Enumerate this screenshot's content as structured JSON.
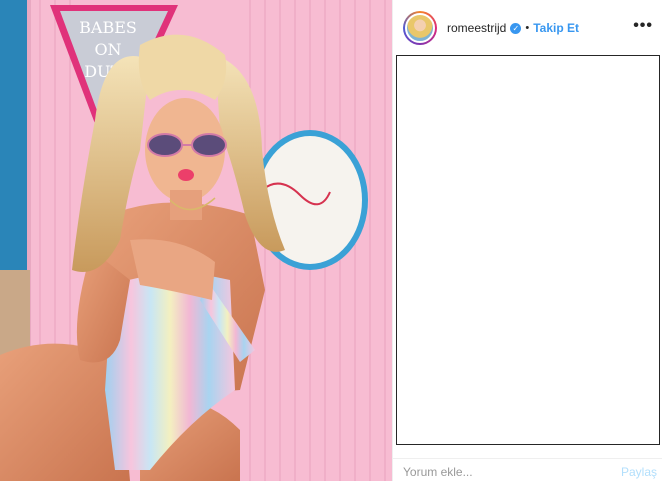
{
  "photo": {
    "sign_text": [
      "BABES",
      "ON",
      "DUTY"
    ],
    "description_icon": "photo-image"
  },
  "header": {
    "username": "romeestrijd",
    "verified_icon": "verified-badge-icon",
    "separator": "•",
    "follow_label": "Takip Et",
    "more_label": "•••"
  },
  "comment": {
    "placeholder": "Yorum ekle...",
    "share_label": "Paylaş"
  },
  "colors": {
    "accent": "#3897f0",
    "share_disabled": "#b2dffc",
    "wall_pink": "#f7b9d0"
  }
}
